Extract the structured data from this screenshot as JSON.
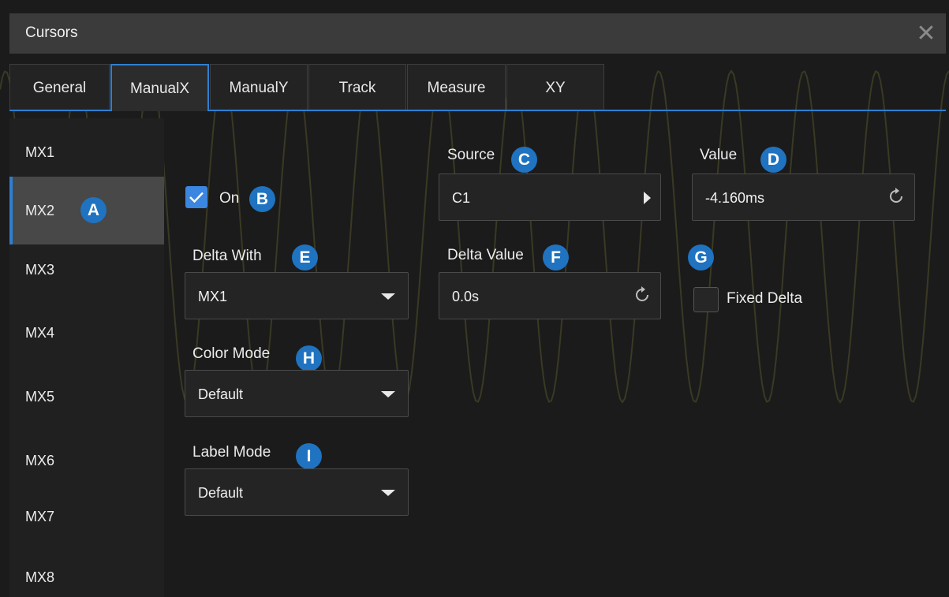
{
  "window": {
    "title": "Cursors",
    "close_glyph": "✕"
  },
  "tabs": [
    {
      "label": "General"
    },
    {
      "label": "ManualX",
      "active": true
    },
    {
      "label": "ManualY"
    },
    {
      "label": "Track"
    },
    {
      "label": "Measure"
    },
    {
      "label": "XY"
    }
  ],
  "sidebar": {
    "items": [
      {
        "label": "MX1"
      },
      {
        "label": "MX2",
        "active": true
      },
      {
        "label": "MX3"
      },
      {
        "label": "MX4"
      },
      {
        "label": "MX5"
      },
      {
        "label": "MX6"
      },
      {
        "label": "MX7"
      },
      {
        "label": "MX8"
      }
    ]
  },
  "on_toggle": {
    "label": "On",
    "checked": true
  },
  "source": {
    "label": "Source",
    "value": "C1"
  },
  "value": {
    "label": "Value",
    "value": "-4.160ms"
  },
  "delta_with": {
    "label": "Delta With",
    "value": "MX1"
  },
  "delta_value": {
    "label": "Delta Value",
    "value": "0.0s"
  },
  "fixed_delta": {
    "label": "Fixed Delta",
    "checked": false
  },
  "color_mode": {
    "label": "Color Mode",
    "value": "Default"
  },
  "label_mode": {
    "label": "Label Mode",
    "value": "Default"
  },
  "badges": {
    "A": "A",
    "B": "B",
    "C": "C",
    "D": "D",
    "E": "E",
    "F": "F",
    "G": "G",
    "H": "H",
    "I": "I"
  },
  "colors": {
    "accent": "#2f7fd0",
    "badge": "#1f73c0",
    "checkbox_on": "#3a86e0",
    "background": "#1b1b1b"
  },
  "icons": {
    "close": "close-icon",
    "checkmark": "checkmark-icon",
    "refresh": "refresh-icon",
    "dropdown": "chevron-down-icon",
    "submenu": "caret-right-icon"
  }
}
